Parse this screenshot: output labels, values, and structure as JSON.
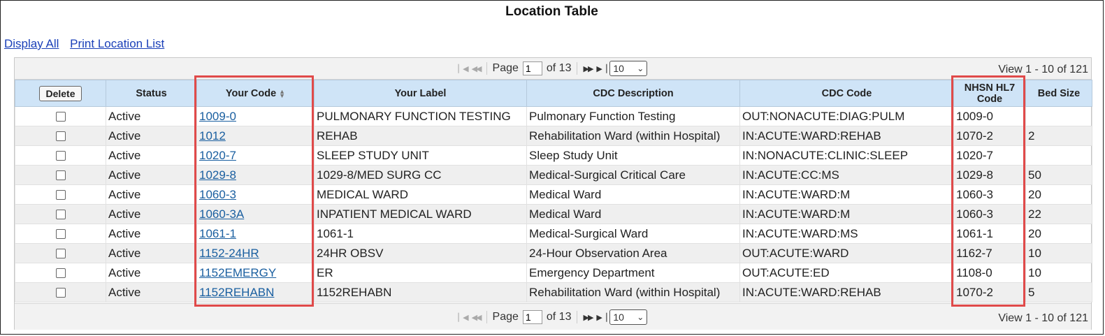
{
  "title": "Location Table",
  "links": {
    "display_all": "Display All",
    "print_list": "Print Location List"
  },
  "pager": {
    "page_label": "Page",
    "page_value": "1",
    "of_label": "of 13",
    "per_page": "10",
    "view_text": "View 1 - 10 of 121"
  },
  "table": {
    "delete_label": "Delete",
    "headers": {
      "status": "Status",
      "your_code": "Your Code",
      "your_label": "Your Label",
      "cdc_description": "CDC Description",
      "cdc_code": "CDC Code",
      "nhsn_line1": "NHSN HL7",
      "nhsn_line2": "Code",
      "bed_size": "Bed Size"
    },
    "rows": [
      {
        "status": "Active",
        "your_code": "1009-0",
        "your_label": "PULMONARY FUNCTION TESTING",
        "cdc_description": "Pulmonary Function Testing",
        "cdc_code": "OUT:NONACUTE:DIAG:PULM",
        "nhsn_code": "1009-0",
        "bed_size": ""
      },
      {
        "status": "Active",
        "your_code": "1012",
        "your_label": "REHAB",
        "cdc_description": "Rehabilitation Ward (within Hospital)",
        "cdc_code": "IN:ACUTE:WARD:REHAB",
        "nhsn_code": "1070-2",
        "bed_size": "2"
      },
      {
        "status": "Active",
        "your_code": "1020-7",
        "your_label": "SLEEP STUDY UNIT",
        "cdc_description": "Sleep Study Unit",
        "cdc_code": "IN:NONACUTE:CLINIC:SLEEP",
        "nhsn_code": "1020-7",
        "bed_size": ""
      },
      {
        "status": "Active",
        "your_code": "1029-8",
        "your_label": "1029-8/MED SURG CC",
        "cdc_description": "Medical-Surgical Critical Care",
        "cdc_code": "IN:ACUTE:CC:MS",
        "nhsn_code": "1029-8",
        "bed_size": "50"
      },
      {
        "status": "Active",
        "your_code": "1060-3",
        "your_label": "MEDICAL WARD",
        "cdc_description": "Medical Ward",
        "cdc_code": "IN:ACUTE:WARD:M",
        "nhsn_code": "1060-3",
        "bed_size": "20"
      },
      {
        "status": "Active",
        "your_code": "1060-3A",
        "your_label": "INPATIENT MEDICAL WARD",
        "cdc_description": "Medical Ward",
        "cdc_code": "IN:ACUTE:WARD:M",
        "nhsn_code": "1060-3",
        "bed_size": "22"
      },
      {
        "status": "Active",
        "your_code": "1061-1",
        "your_label": "1061-1",
        "cdc_description": "Medical-Surgical Ward",
        "cdc_code": "IN:ACUTE:WARD:MS",
        "nhsn_code": "1061-1",
        "bed_size": "20"
      },
      {
        "status": "Active",
        "your_code": "1152-24HR",
        "your_label": "24HR OBSV",
        "cdc_description": "24-Hour Observation Area",
        "cdc_code": "OUT:ACUTE:WARD",
        "nhsn_code": "1162-7",
        "bed_size": "10"
      },
      {
        "status": "Active",
        "your_code": "1152EMERGY",
        "your_label": "ER",
        "cdc_description": "Emergency Department",
        "cdc_code": "OUT:ACUTE:ED",
        "nhsn_code": "1108-0",
        "bed_size": "10"
      },
      {
        "status": "Active",
        "your_code": "1152REHABN",
        "your_label": "1152REHABN",
        "cdc_description": "Rehabilitation Ward (within Hospital)",
        "cdc_code": "IN:ACUTE:WARD:REHAB",
        "nhsn_code": "1070-2",
        "bed_size": "5"
      }
    ]
  },
  "colors": {
    "link": "#1a5fa0",
    "header_bg": "#cfe4f7",
    "highlight": "#e04a4a"
  }
}
